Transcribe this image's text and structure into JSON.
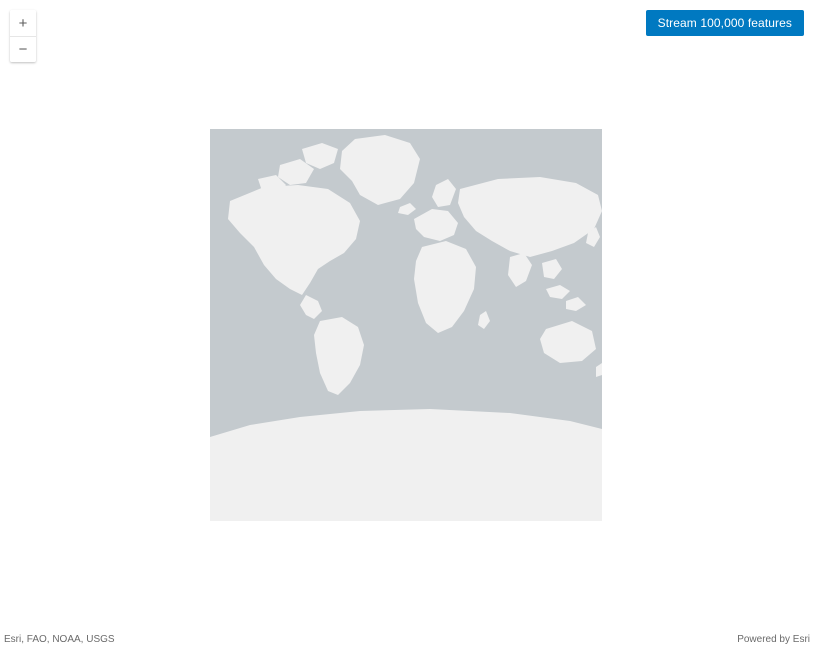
{
  "controls": {
    "zoom_in": "+",
    "zoom_out": "−"
  },
  "buttons": {
    "stream": "Stream 100,000 features"
  },
  "attribution": {
    "sources": "Esri, FAO, NOAA, USGS",
    "powered": "Powered by Esri"
  },
  "map": {
    "ocean_color": "#c4cace",
    "land_color": "#f0f0f0"
  }
}
